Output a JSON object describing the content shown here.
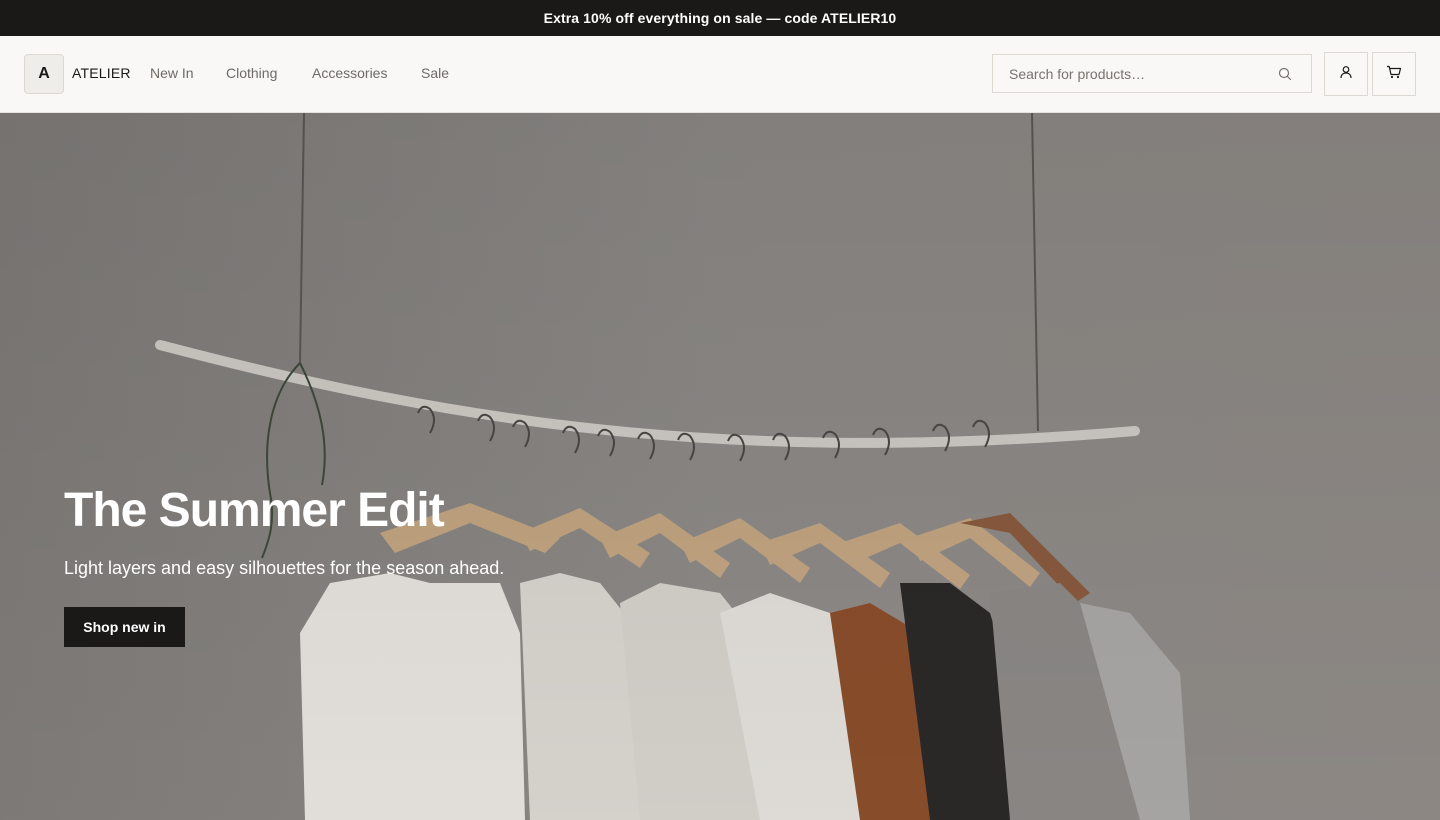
{
  "promo": {
    "text": "Extra 10% off everything on sale — code ATELIER10"
  },
  "header": {
    "logo_letter": "A",
    "brand": "ATELIER",
    "nav": [
      "New In",
      "Clothing",
      "Accessories",
      "Sale"
    ],
    "search": {
      "placeholder": "Search for products…",
      "value": ""
    },
    "icons": {
      "search": "search-icon",
      "account": "user-icon",
      "cart": "cart-icon"
    }
  },
  "hero": {
    "title": "The Summer Edit",
    "subtitle": "Light layers and easy silhouettes for the season ahead.",
    "cta": "Shop new in"
  },
  "colors": {
    "dark": "#1a1918",
    "background": "#f9f8f6",
    "muted_text": "#6e6b67"
  }
}
